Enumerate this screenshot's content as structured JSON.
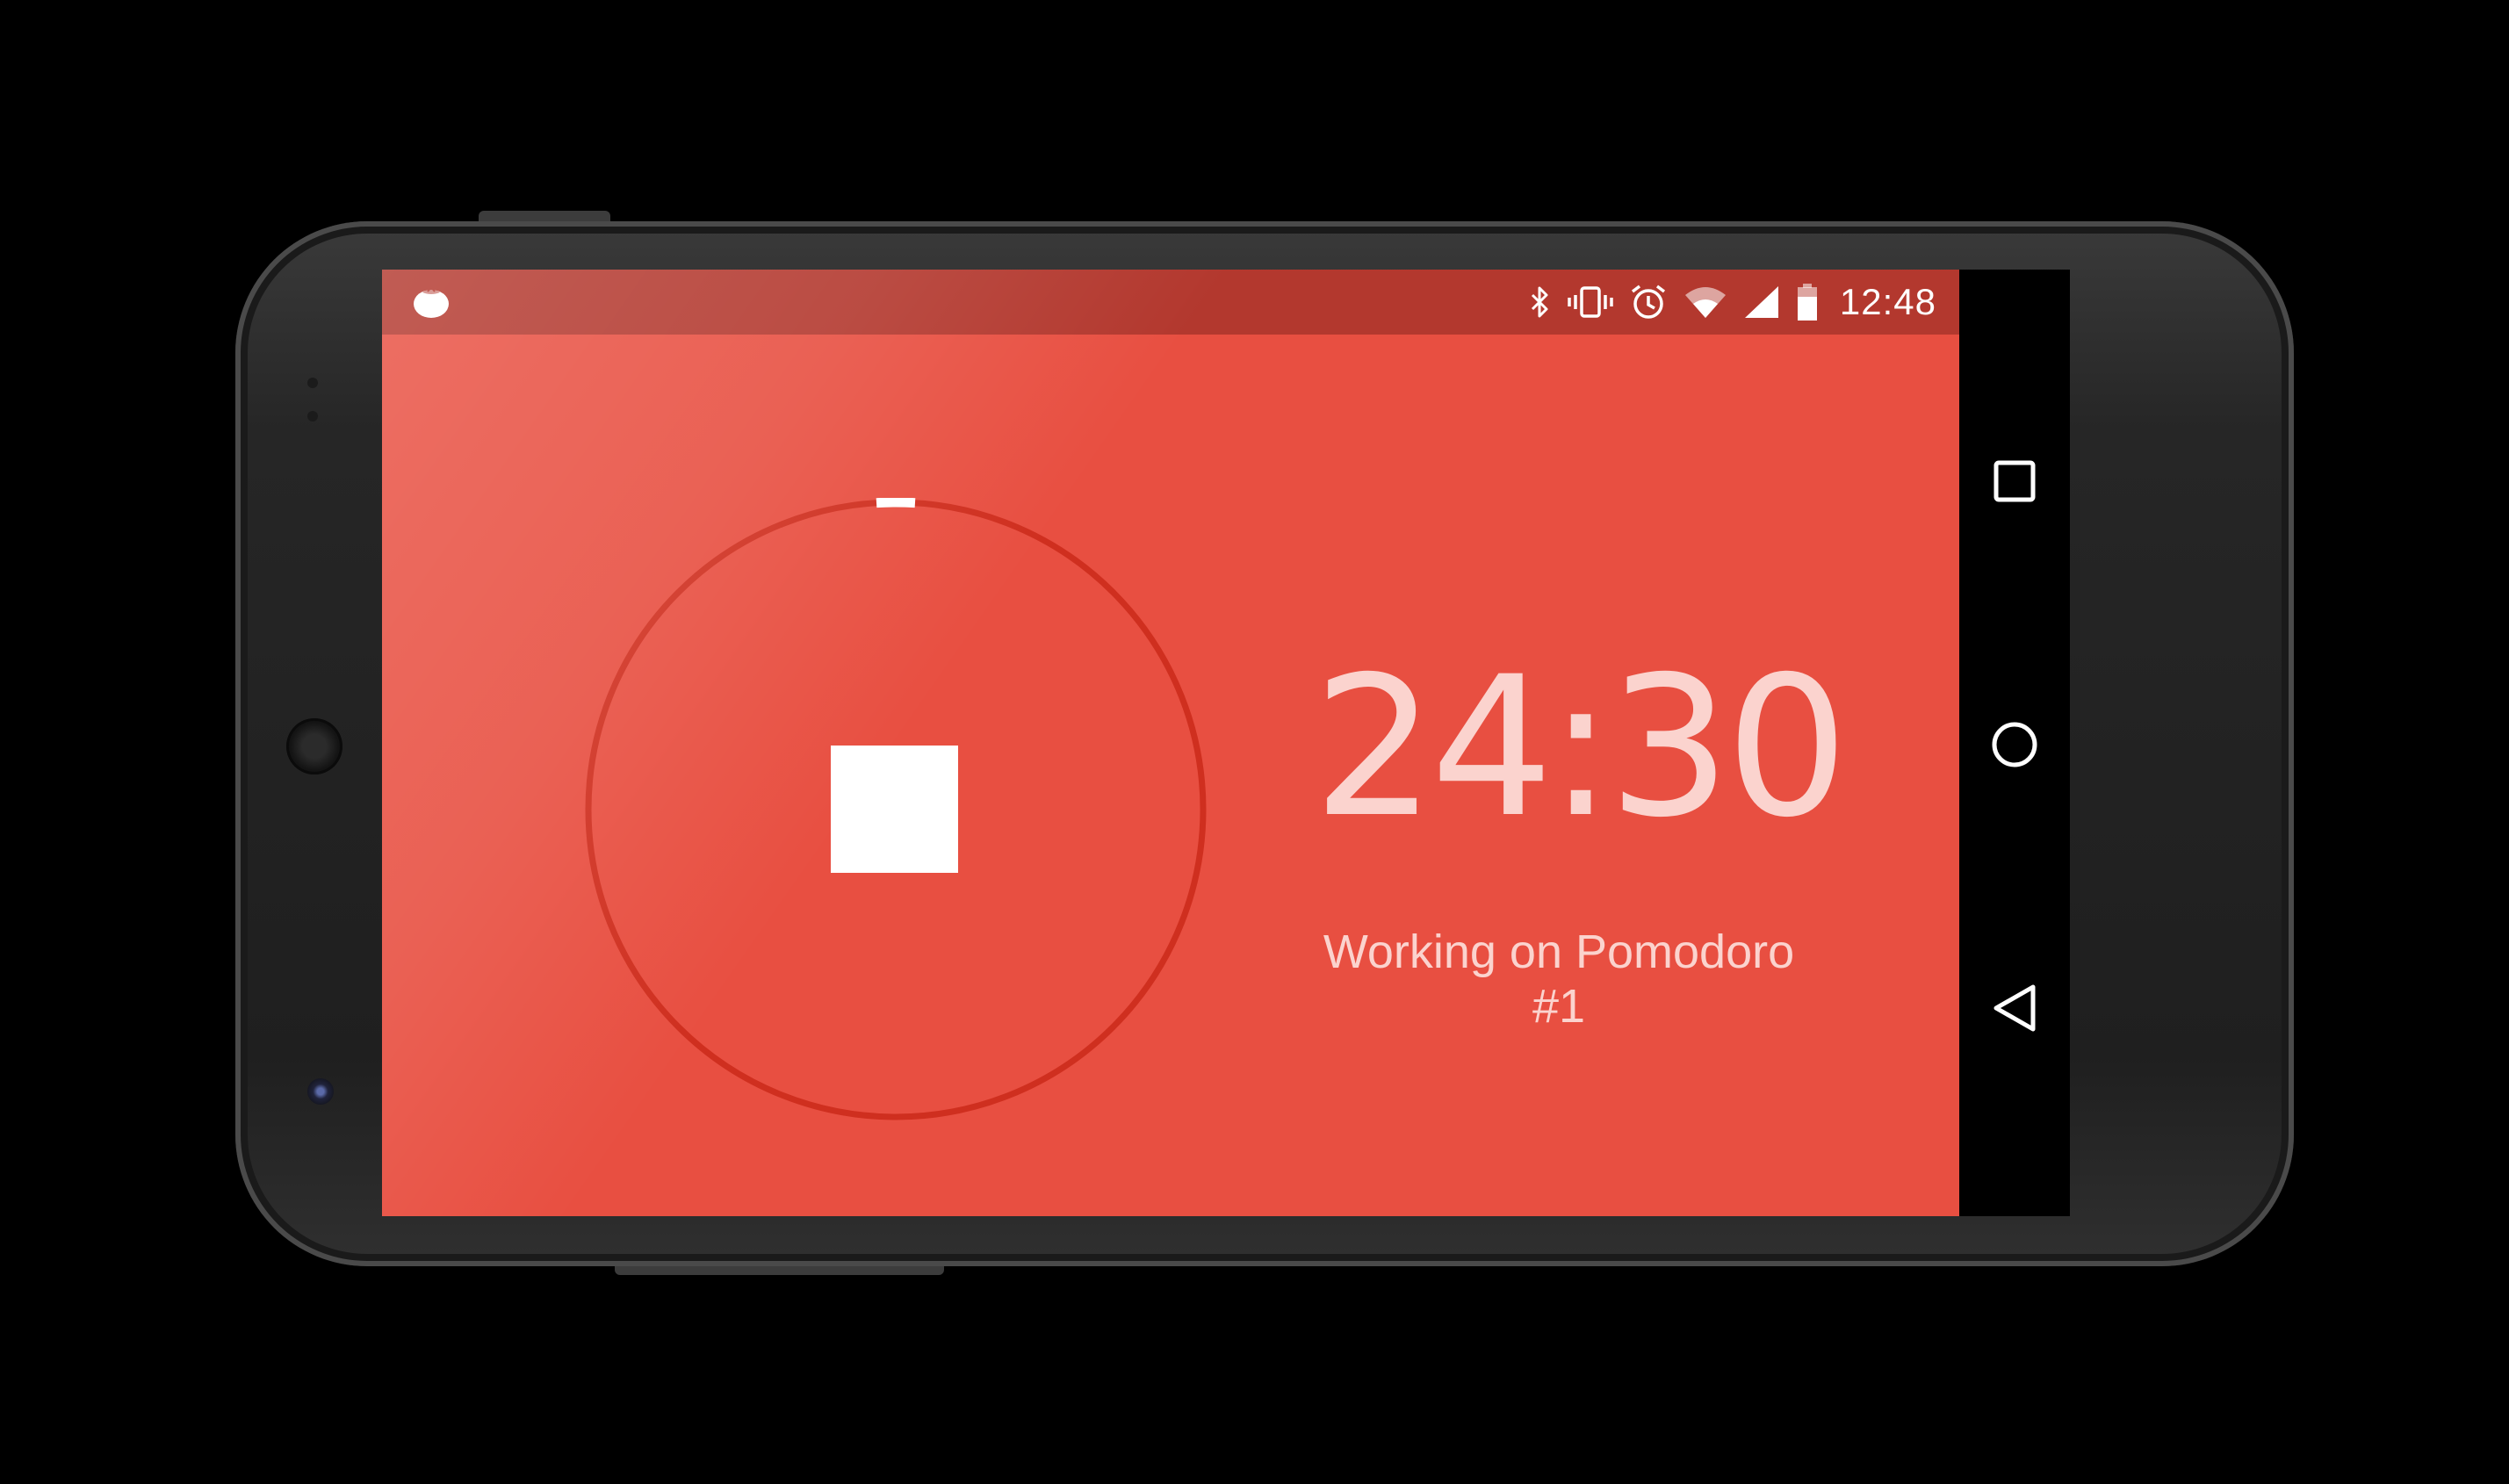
{
  "status_bar": {
    "time": "12:48",
    "icons": [
      "bluetooth-icon",
      "vibrate-icon",
      "alarm-icon",
      "wifi-icon",
      "signal-icon",
      "battery-icon"
    ]
  },
  "app": {
    "icon": "tomato-icon",
    "timer": "24:30",
    "status_text": "Working on Pomodoro #1",
    "progress_fraction": 0.02,
    "accent_color": "#e84f41",
    "status_bar_color": "#b3382e"
  },
  "nav": {
    "buttons": [
      "recents-icon",
      "home-icon",
      "back-icon"
    ]
  }
}
